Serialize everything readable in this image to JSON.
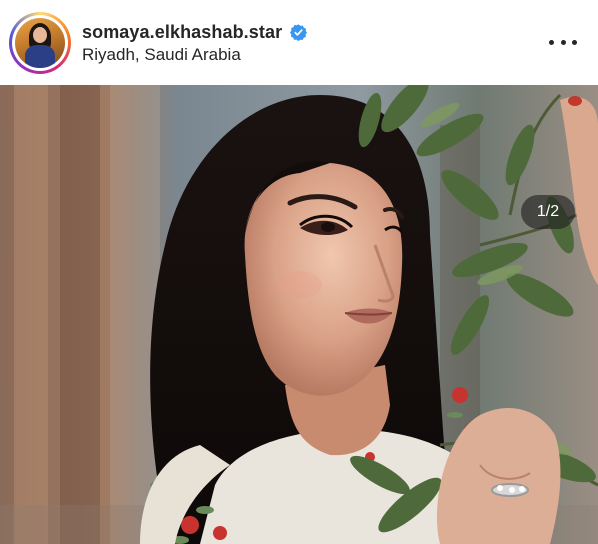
{
  "post": {
    "username": "somaya.elkhashab.star",
    "location": "Riyadh, Saudi Arabia",
    "verified": true
  },
  "media": {
    "counter": "1/2",
    "current": 1,
    "total": 2
  },
  "icons": {
    "verified": "verified-badge-icon",
    "more": "more-options-icon"
  },
  "colors": {
    "verified_badge": "#3897f0",
    "text": "#262626"
  }
}
